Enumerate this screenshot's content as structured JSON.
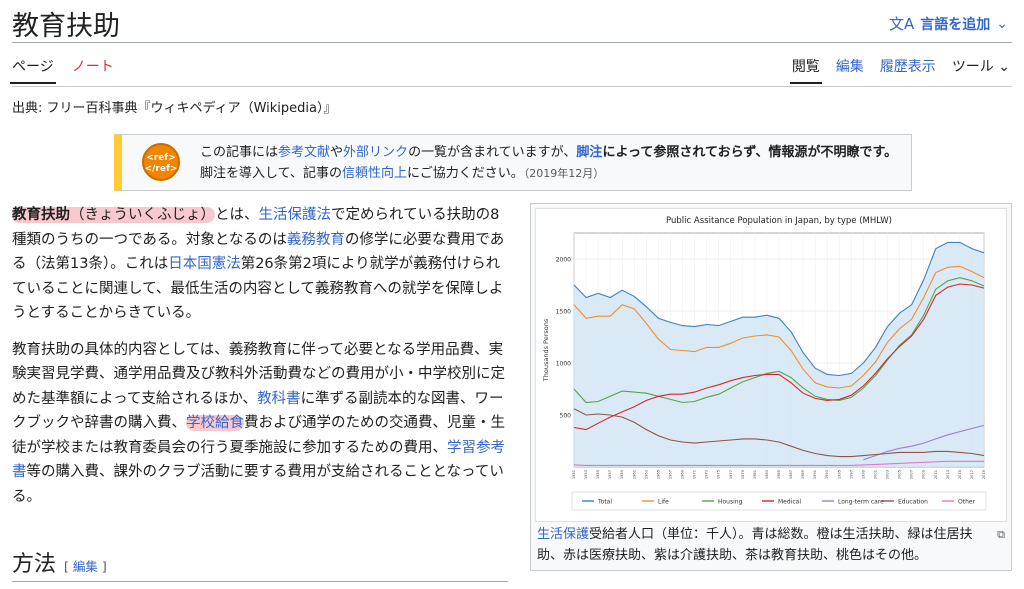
{
  "page": {
    "title": "教育扶助",
    "lang_button": "言語を追加",
    "source": "出典: フリー百科事典『ウィキペディア（Wikipedia）』"
  },
  "tabs": {
    "page": "ページ",
    "talk": "ノート",
    "read": "閲覧",
    "edit": "編集",
    "history": "履歴表示",
    "tools": "ツール"
  },
  "notice": {
    "icon_text_1": "<ref>",
    "icon_text_2": "</ref>",
    "t1": "この記事には",
    "l1": "参考文献",
    "t2": "や",
    "l2": "外部リンク",
    "t3": "の一覧が含まれていますが、",
    "l3": "脚注",
    "t4": "によって参照されておらず、情報源が不明瞭です。",
    "t5": "脚注を導入して、記事の",
    "l4": "信頼性向上",
    "t6": "にご協力ください。",
    "date": "（2019年12月）"
  },
  "para1": {
    "term": "教育扶助",
    "reading": "（きょういくふじょ）",
    "t1": "とは、",
    "l1": "生活保護法",
    "t2": "で定められている扶助の8種類のうちの一つである。対象となるのは",
    "l2": "義務教育",
    "t3": "の修学に必要な費用である（法第13条）。これは",
    "l3": "日本国憲法",
    "t4": "第26条第2項により就学が義務付けられていることに関連して、最低生活の内容として義務教育への就学を保障しようとすることからきている。"
  },
  "para2": {
    "t1": "教育扶助の具体的内容としては、義務教育に伴って必要となる学用品費、実験実習見学費、通学用品費及び教科外活動費などの費用が小・中学校別に定めた基準額によって支給されるほか、",
    "l1": "教科書",
    "t2": "に準ずる副読本的な図書、ワークブックや辞書の購入費、",
    "l2": "学校給食",
    "t3": "費および通学のための交通費、児童・生徒が学校または教育委員会の行う夏季施設に参加するための費用、",
    "l3": "学習参考書",
    "t4": "等の購入費、課外のクラブ活動に要する費用が支給されることとなっている。"
  },
  "section": {
    "heading": "方法",
    "edit_open": "[ ",
    "edit": "編集",
    "edit_close": " ]"
  },
  "figure": {
    "caption_link": "生活保護",
    "caption_text": "受給者人口（単位：千人）。青は総数。橙は生活扶助、緑は住居扶助、赤は医療扶助、紫は介護扶助、茶は教育扶助、桃色はその他。"
  },
  "chart_data": {
    "type": "line",
    "title": "Public Assitance Population in Japan, by type (MHLW)",
    "ylabel": "Thousands Persons",
    "xlabel": "",
    "ylim": [
      0,
      2250
    ],
    "yticks": [
      500,
      1000,
      1500,
      2000
    ],
    "x": [
      1951,
      1953,
      1955,
      1957,
      1959,
      1961,
      1963,
      1965,
      1967,
      1969,
      1971,
      1973,
      1975,
      1977,
      1979,
      1981,
      1983,
      1985,
      1987,
      1989,
      1991,
      1993,
      1995,
      1997,
      1999,
      2001,
      2003,
      2005,
      2007,
      2009,
      2011,
      2013,
      2015,
      2017,
      2019
    ],
    "legend": [
      "Total",
      "Life",
      "Housing",
      "Medical",
      "Long-term care",
      "Education",
      "Other"
    ],
    "series": [
      {
        "name": "Total",
        "color": "#3b82c4",
        "values": [
          1750,
          1630,
          1670,
          1630,
          1700,
          1640,
          1540,
          1430,
          1390,
          1360,
          1350,
          1370,
          1360,
          1400,
          1440,
          1440,
          1460,
          1430,
          1300,
          1100,
          950,
          890,
          880,
          900,
          1000,
          1150,
          1350,
          1480,
          1560,
          1800,
          2100,
          2160,
          2160,
          2100,
          2060
        ]
      },
      {
        "name": "Life",
        "color": "#f28e2b",
        "values": [
          1560,
          1430,
          1450,
          1450,
          1560,
          1520,
          1380,
          1230,
          1130,
          1120,
          1110,
          1150,
          1150,
          1190,
          1240,
          1260,
          1270,
          1250,
          1120,
          940,
          810,
          770,
          760,
          780,
          880,
          1010,
          1200,
          1330,
          1420,
          1630,
          1870,
          1920,
          1930,
          1880,
          1820
        ]
      },
      {
        "name": "Housing",
        "color": "#59a14f",
        "values": [
          750,
          620,
          630,
          680,
          730,
          720,
          710,
          680,
          650,
          620,
          630,
          670,
          700,
          760,
          820,
          860,
          900,
          920,
          860,
          760,
          680,
          650,
          640,
          670,
          760,
          880,
          1030,
          1170,
          1270,
          1460,
          1710,
          1790,
          1820,
          1790,
          1740
        ]
      },
      {
        "name": "Medical",
        "color": "#d62728",
        "values": [
          380,
          360,
          420,
          480,
          530,
          580,
          640,
          680,
          700,
          700,
          720,
          760,
          790,
          830,
          860,
          880,
          890,
          890,
          810,
          710,
          660,
          640,
          650,
          690,
          780,
          900,
          1040,
          1160,
          1260,
          1420,
          1650,
          1730,
          1760,
          1750,
          1720
        ]
      },
      {
        "name": "Long-term care",
        "color": "#9b7fd1",
        "values": [
          null,
          null,
          null,
          null,
          null,
          null,
          null,
          null,
          null,
          null,
          null,
          null,
          null,
          null,
          null,
          null,
          null,
          null,
          null,
          null,
          null,
          null,
          null,
          null,
          70,
          110,
          150,
          180,
          200,
          230,
          270,
          310,
          340,
          370,
          400
        ]
      },
      {
        "name": "Education",
        "color": "#8c564b",
        "values": [
          560,
          500,
          510,
          500,
          480,
          430,
          360,
          300,
          260,
          240,
          230,
          240,
          250,
          260,
          270,
          270,
          260,
          240,
          200,
          160,
          130,
          110,
          100,
          100,
          110,
          120,
          130,
          140,
          140,
          140,
          150,
          150,
          140,
          130,
          110
        ]
      },
      {
        "name": "Other",
        "color": "#e377c2",
        "values": [
          20,
          15,
          15,
          15,
          15,
          15,
          15,
          15,
          15,
          15,
          15,
          15,
          15,
          15,
          15,
          15,
          15,
          15,
          15,
          15,
          15,
          15,
          15,
          15,
          20,
          25,
          30,
          35,
          40,
          45,
          50,
          55,
          55,
          55,
          55
        ]
      }
    ]
  }
}
